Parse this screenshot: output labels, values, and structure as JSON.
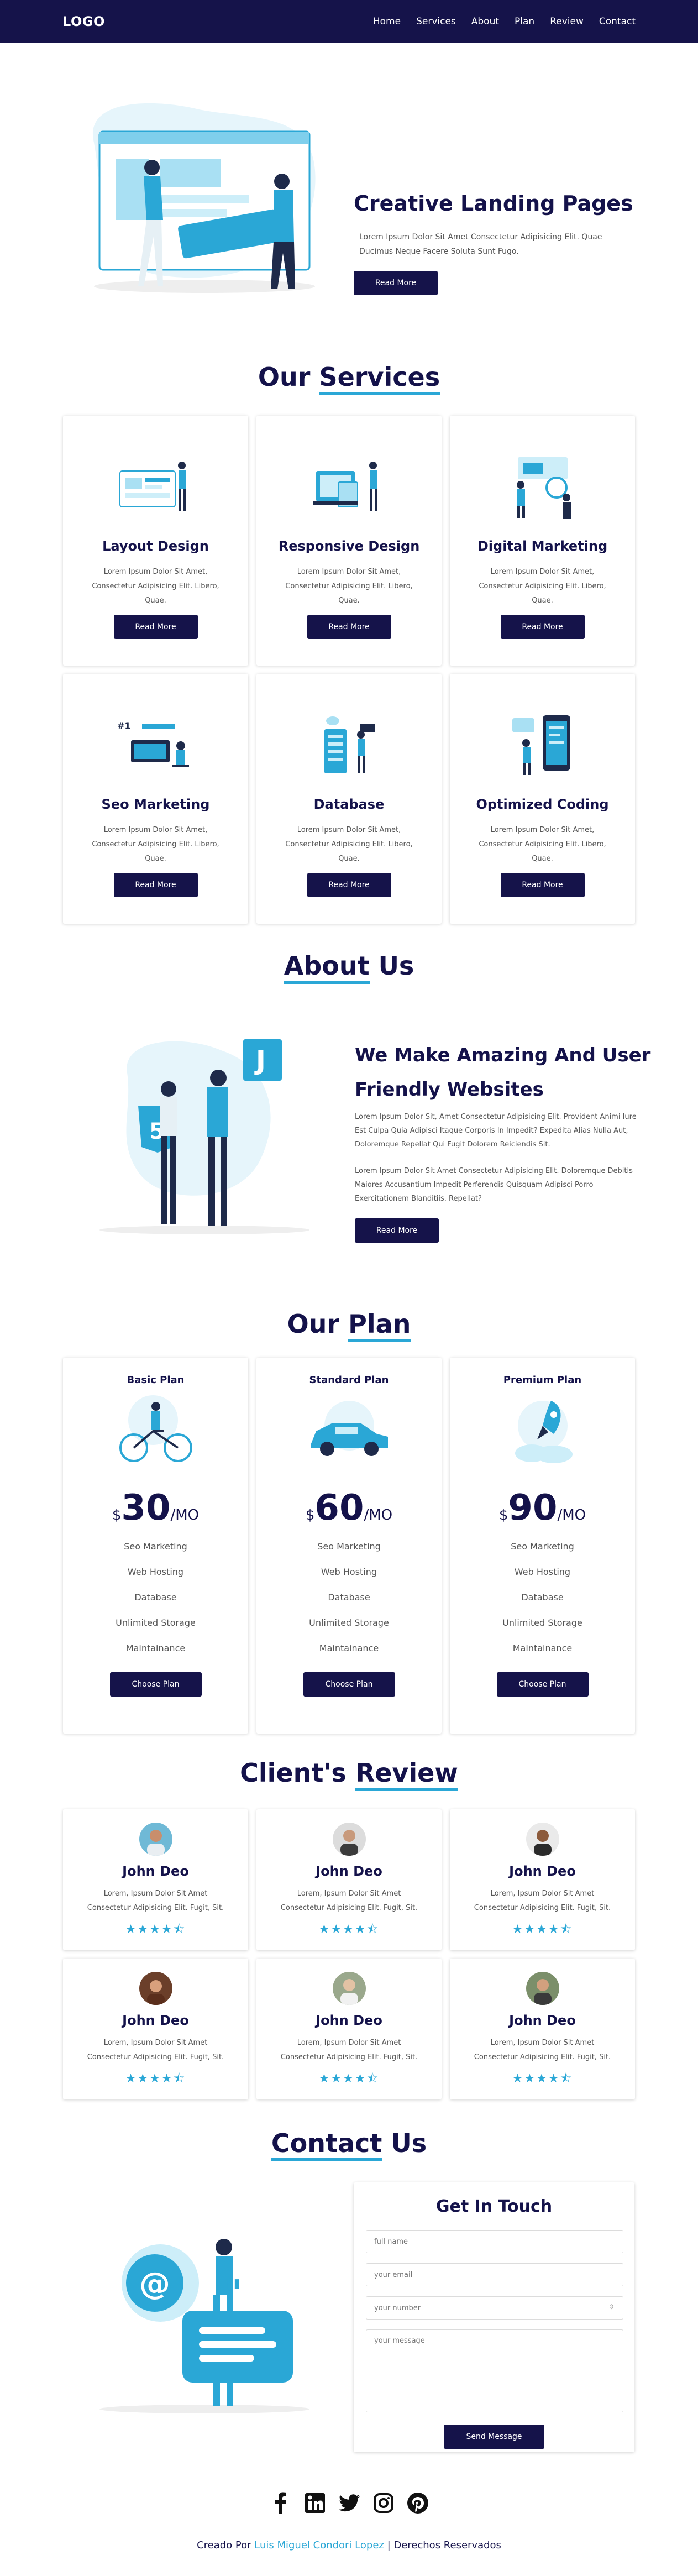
{
  "nav": {
    "logo": "LOGO",
    "links": [
      "Home",
      "Services",
      "About",
      "Plan",
      "Review",
      "Contact"
    ]
  },
  "hero": {
    "title": "Creative Landing Pages",
    "text": "Lorem Ipsum Dolor Sit Amet Consectetur Adipisicing Elit. Quae Ducimus Neque Facere Soluta Sunt Fugo.",
    "button": "Read More"
  },
  "services": {
    "title_plain": "Our ",
    "title_underlined": "Services",
    "items": [
      {
        "title": "Layout Design",
        "text": "Lorem Ipsum Dolor Sit Amet, Consectetur Adipisicing Elit. Libero, Quae.",
        "button": "Read More"
      },
      {
        "title": "Responsive Design",
        "text": "Lorem Ipsum Dolor Sit Amet, Consectetur Adipisicing Elit. Libero, Quae.",
        "button": "Read More"
      },
      {
        "title": "Digital Marketing",
        "text": "Lorem Ipsum Dolor Sit Amet, Consectetur Adipisicing Elit. Libero, Quae.",
        "button": "Read More"
      },
      {
        "title": "Seo Marketing",
        "text": "Lorem Ipsum Dolor Sit Amet, Consectetur Adipisicing Elit. Libero, Quae.",
        "button": "Read More"
      },
      {
        "title": "Database",
        "text": "Lorem Ipsum Dolor Sit Amet, Consectetur Adipisicing Elit. Libero, Quae.",
        "button": "Read More"
      },
      {
        "title": "Optimized Coding",
        "text": "Lorem Ipsum Dolor Sit Amet, Consectetur Adipisicing Elit. Libero, Quae.",
        "button": "Read More"
      }
    ]
  },
  "about": {
    "title_underlined": "About",
    "title_plain": " Us",
    "heading": "We Make Amazing And User Friendly Websites",
    "para1": "Lorem Ipsum Dolor Sit, Amet Consectetur Adipisicing Elit. Provident Animi Iure Est Culpa Quia Adipisci Itaque Corporis In Impedit? Expedita Alias Nulla Aut, Doloremque Repellat Qui Fugit Dolorem Reiciendis Sit.",
    "para2": "Lorem Ipsum Dolor Sit Amet Consectetur Adipisicing Elit. Doloremque Debitis Maiores Accusantium Impedit Perferendis Quisquam Adipisci Porro Exercitationem Blanditiis. Repellat?",
    "button": "Read More"
  },
  "plan": {
    "title_plain": "Our ",
    "title_underlined": "Plan",
    "items": [
      {
        "name": "Basic Plan",
        "currency": "$",
        "amount": "30",
        "period": "/MO",
        "features": [
          "Seo Marketing",
          "Web Hosting",
          "Database",
          "Unlimited Storage",
          "Maintainance"
        ],
        "button": "Choose Plan"
      },
      {
        "name": "Standard Plan",
        "currency": "$",
        "amount": "60",
        "period": "/MO",
        "features": [
          "Seo Marketing",
          "Web Hosting",
          "Database",
          "Unlimited Storage",
          "Maintainance"
        ],
        "button": "Choose Plan"
      },
      {
        "name": "Premium Plan",
        "currency": "$",
        "amount": "90",
        "period": "/MO",
        "features": [
          "Seo Marketing",
          "Web Hosting",
          "Database",
          "Unlimited Storage",
          "Maintainance"
        ],
        "button": "Choose Plan"
      }
    ]
  },
  "review": {
    "title_plain": "Client's ",
    "title_underlined": "Review",
    "items": [
      {
        "name": "John Deo",
        "text": "Lorem, Ipsum Dolor Sit Amet Consectetur Adipisicing Elit. Fugit, Sit.",
        "stars": "★★★★⯪",
        "rating": 4.5
      },
      {
        "name": "John Deo",
        "text": "Lorem, Ipsum Dolor Sit Amet Consectetur Adipisicing Elit. Fugit, Sit.",
        "stars": "★★★★⯪",
        "rating": 4.5
      },
      {
        "name": "John Deo",
        "text": "Lorem, Ipsum Dolor Sit Amet Consectetur Adipisicing Elit. Fugit, Sit.",
        "stars": "★★★★⯪",
        "rating": 4.5
      },
      {
        "name": "John Deo",
        "text": "Lorem, Ipsum Dolor Sit Amet Consectetur Adipisicing Elit. Fugit, Sit.",
        "stars": "★★★★⯪",
        "rating": 4.5
      },
      {
        "name": "John Deo",
        "text": "Lorem, Ipsum Dolor Sit Amet Consectetur Adipisicing Elit. Fugit, Sit.",
        "stars": "★★★★⯪",
        "rating": 4.5
      },
      {
        "name": "John Deo",
        "text": "Lorem, Ipsum Dolor Sit Amet Consectetur Adipisicing Elit. Fugit, Sit.",
        "stars": "★★★★⯪",
        "rating": 4.5
      }
    ]
  },
  "contact": {
    "title_plain": "Contact",
    "title_underlined": " Us",
    "form_title": "Get In Touch",
    "name_placeholder": "full name",
    "email_placeholder": "your email",
    "number_placeholder": "your number",
    "message_placeholder": "your message",
    "button": "Send Message"
  },
  "social": [
    "facebook-icon",
    "linkedin-icon",
    "twitter-icon",
    "instagram-icon",
    "pinterest-icon"
  ],
  "footer": {
    "prefix": "Creado Por ",
    "author": "Luis Miguel Condori Lopez",
    "suffix": " | Derechos Reservados"
  },
  "colors": {
    "navy": "#15134a",
    "accent": "#2aa7d6"
  }
}
